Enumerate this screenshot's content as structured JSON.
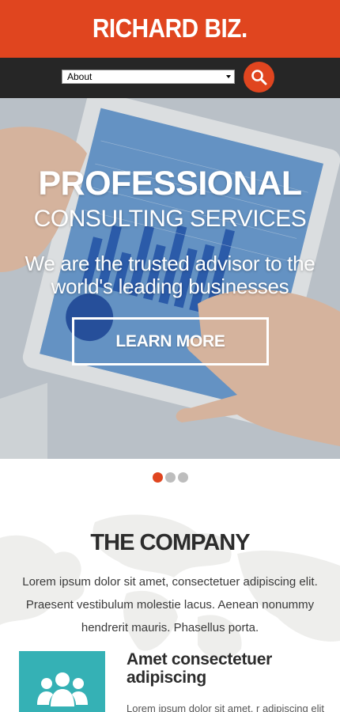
{
  "header": {
    "logo": "RICHARD BIZ."
  },
  "nav": {
    "selected": "About",
    "search_icon": "search-icon"
  },
  "hero": {
    "title": "PROFESSIONAL",
    "subtitle": "CONSULTING SERVICES",
    "text": "We are the trusted advisor to the world's leading businesses",
    "button": "LEARN MORE",
    "slides": 3,
    "active_slide": 1
  },
  "company": {
    "title": "THE COMPANY",
    "text": "Lorem ipsum dolor sit amet, consectetuer adipiscing elit. Praesent vestibulum molestie lacus. Aenean nonummy hendrerit mauris. Phasellus porta.",
    "feature": {
      "icon": "users-icon",
      "title": "Amet consectetuer adipiscing",
      "text": "Lorem ipsum dolor sit amet, r adipiscing elit"
    }
  },
  "colors": {
    "accent": "#e0451f",
    "dark_bar": "#262626",
    "teal": "#35b1b5"
  }
}
